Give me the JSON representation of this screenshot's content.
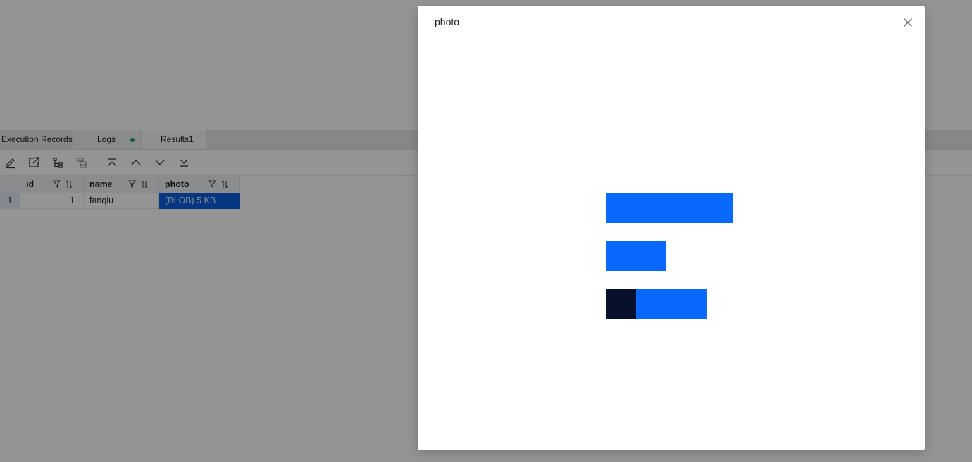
{
  "result_tabs": {
    "execution_records": "Execution Records",
    "logs": "Logs",
    "results": "Results1"
  },
  "toolbar": {
    "icons": [
      "edit-icon",
      "export-icon",
      "tree-view-icon",
      "layout-icon",
      "first-row-icon",
      "previous-row-icon",
      "next-row-icon",
      "last-row-icon"
    ]
  },
  "grid": {
    "columns": [
      "id",
      "name",
      "photo"
    ],
    "rows": [
      {
        "row_number": "1",
        "id": "1",
        "name": "fanqiu",
        "photo": "(BLOB) 5 KB"
      }
    ]
  },
  "modal": {
    "title": "photo",
    "close_icon": "close-icon",
    "image": {
      "description_colors": {
        "blue": "#0969ff",
        "navy": "#08102b"
      }
    }
  },
  "colors": {
    "selected_cell": "#0a5ee0",
    "logs_status_dot": "#16a37a",
    "overlay": "rgba(0,0,0,0.42)"
  }
}
